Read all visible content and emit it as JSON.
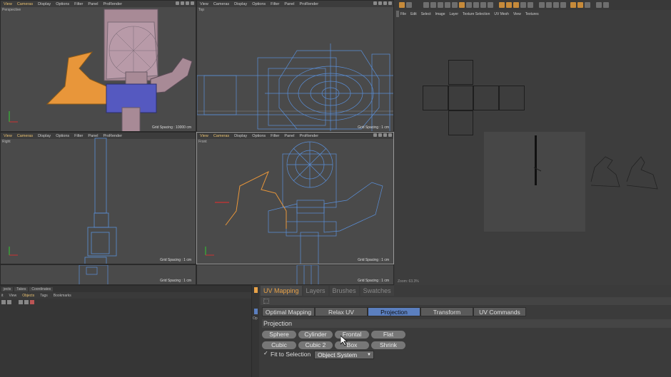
{
  "viewports": [
    {
      "id": "perspective",
      "label": "Perspective",
      "menu": [
        "View",
        "Cameras",
        "Display",
        "Options",
        "Filter",
        "Panel",
        "ProRender"
      ],
      "grid": "Grid Spacing : 10000 cm"
    },
    {
      "id": "top",
      "label": "Top",
      "menu": [
        "View",
        "Cameras",
        "Display",
        "Options",
        "Filter",
        "Panel",
        "ProRender"
      ],
      "grid": "Grid Spacing : 1 cm"
    },
    {
      "id": "right",
      "label": "Right",
      "menu": [
        "View",
        "Cameras",
        "Display",
        "Options",
        "Filter",
        "Panel",
        "ProRender"
      ],
      "grid": "Grid Spacing : 1 cm"
    },
    {
      "id": "front",
      "label": "Front",
      "menu": [
        "View",
        "Cameras",
        "Display",
        "Options",
        "Filter",
        "Panel",
        "ProRender"
      ],
      "grid": "Grid Spacing : 1 cm"
    }
  ],
  "under_grid": "Grid Spacing : 1 cm",
  "uv_editor": {
    "menu": [
      "File",
      "Edit",
      "Select",
      "Image",
      "Layer",
      "Texture Selection",
      "UV Mesh",
      "View",
      "Textures"
    ],
    "status": "Zoom: 63.3%"
  },
  "object_manager": {
    "tabs": [
      "jects",
      "Takes",
      "Coordinates"
    ],
    "menu": [
      "it",
      "View",
      "Objects",
      "Tags",
      "Bookmarks"
    ]
  },
  "uv_panel": {
    "tabs": [
      "UV Mapping",
      "Layers",
      "Brushes",
      "Swatches"
    ],
    "side_label": "Op",
    "mode_tabs": [
      "Optimal Mapping",
      "Relax UV",
      "Projection",
      "Transform",
      "UV Commands"
    ],
    "active_mode": "Projection",
    "section_title": "Projection",
    "projection_buttons": [
      "Sphere",
      "Cylinder",
      "Frontal",
      "Flat",
      "Cubic",
      "Cubic 2",
      "Box",
      "Shrink"
    ],
    "fit_to_selection_label": "Fit to Selection",
    "fit_to_selection_checked": true,
    "object_system_value": "Object System"
  },
  "colors": {
    "accent": "#e8a248",
    "active_tab": "#5b7fbf",
    "wire_blue": "#5a8fd8",
    "selection_orange": "#e8963a"
  }
}
